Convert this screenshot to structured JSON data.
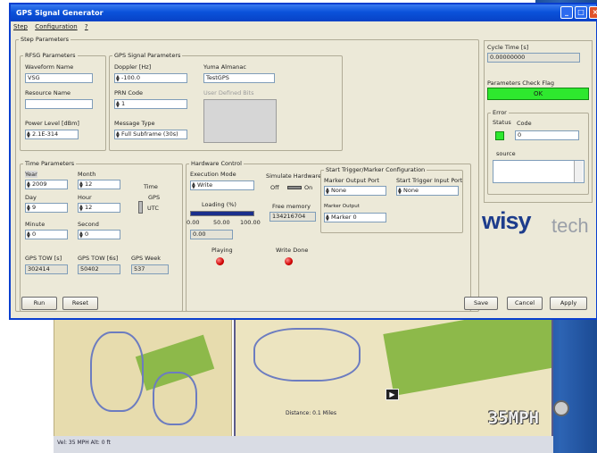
{
  "window": {
    "title": "GPS Signal Generator"
  },
  "menu": [
    "Step",
    "Configuration",
    "?"
  ],
  "step_params": {
    "legend": "Step Parameters",
    "rfsg": {
      "legend": "RFSG Parameters",
      "waveform_label": "Waveform Name",
      "waveform_value": "VSG",
      "resource_label": "Resource Name",
      "resource_value": "",
      "power_label": "Power Level [dBm]",
      "power_value": "2.1E-314"
    },
    "gps": {
      "legend": "GPS Signal Parameters",
      "doppler_label": "Doppler [Hz]",
      "doppler_value": "-100.0",
      "prn_label": "PRN Code",
      "prn_value": "1",
      "msg_label": "Message Type",
      "msg_value": "Full Subframe (30s)",
      "yuma_label": "Yuma Almanac",
      "yuma_value": "TestGPS",
      "bits_label": "User Defined Bits"
    }
  },
  "time": {
    "legend": "Time Parameters",
    "year_label": "Year",
    "year_value": "2009",
    "month_label": "Month",
    "month_value": "12",
    "day_label": "Day",
    "day_value": "9",
    "hour_label": "Hour",
    "hour_value": "12",
    "minute_label": "Minute",
    "minute_value": "0",
    "second_label": "Second",
    "second_value": "0",
    "time_label": "Time",
    "gps_label": "GPS",
    "utc_label": "UTC",
    "tow_s_label": "GPS TOW [s]",
    "tow_s_value": "302414",
    "tow_6s_label": "GPS TOW [6s]",
    "tow_6s_value": "50402",
    "week_label": "GPS Week",
    "week_value": "537"
  },
  "hardware": {
    "legend": "Hardware Control",
    "exec_label": "Execution Mode",
    "exec_value": "Write",
    "sim_label": "Simulate Hardware",
    "off_label": "Off",
    "on_label": "On",
    "loading_label": "Loading (%)",
    "loading_fraction": 1.0,
    "scale": [
      "0.00",
      "50.00",
      "100.00"
    ],
    "loading_value": "0.00",
    "free_mem_label": "Free memory",
    "free_mem_value": "134216704",
    "playing_label": "Playing",
    "write_done_label": "Write Done"
  },
  "trigger": {
    "legend": "Start Trigger/Marker Configuration",
    "marker_port_label": "Marker Output Port",
    "marker_port_value": "None",
    "start_port_label": "Start Trigger Input Port",
    "start_port_value": "None",
    "marker_out_label": "Marker Output",
    "marker_out_value": "Marker 0"
  },
  "side": {
    "cycle_label": "Cycle Time [s]",
    "cycle_value": "0.00000000",
    "check_label": "Parameters Check Flag",
    "check_value": "OK",
    "error_legend": "Error",
    "status_label": "Status",
    "code_label": "Code",
    "code_value": "0",
    "source_label": "source"
  },
  "buttons": {
    "run": "Run",
    "reset": "Reset",
    "save": "Save",
    "cancel": "Cancel",
    "apply": "Apply"
  },
  "logo": {
    "brand": "wisy",
    "suffix": "tech"
  },
  "map": {
    "speed": "35MPH",
    "status": "Vel: 35 MPH  Alt: 0 ft",
    "distance": "Distance: 0.1 Miles"
  },
  "colors": {
    "title_bar": "#0a52da",
    "ok_green": "#2ee82e",
    "led_red": "#d00000",
    "logo_blue": "#1d3c8c"
  }
}
